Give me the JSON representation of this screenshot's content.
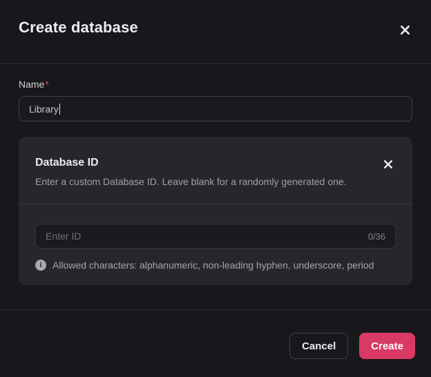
{
  "header": {
    "title": "Create database"
  },
  "name_field": {
    "label": "Name",
    "required_marker": "*",
    "value": "Library"
  },
  "id_card": {
    "title": "Database ID",
    "description": "Enter a custom Database ID. Leave blank for a randomly generated one.",
    "input": {
      "placeholder": "Enter ID",
      "counter": "0/36"
    },
    "hint": "Allowed characters: alphanumeric, non-leading hyphen, underscore, period",
    "info_icon_glyph": "i"
  },
  "footer": {
    "cancel_label": "Cancel",
    "create_label": "Create"
  },
  "colors": {
    "accent": "#d83a64",
    "required": "#e5484d",
    "modal_bg": "#18181c",
    "card_bg": "#26262b"
  }
}
